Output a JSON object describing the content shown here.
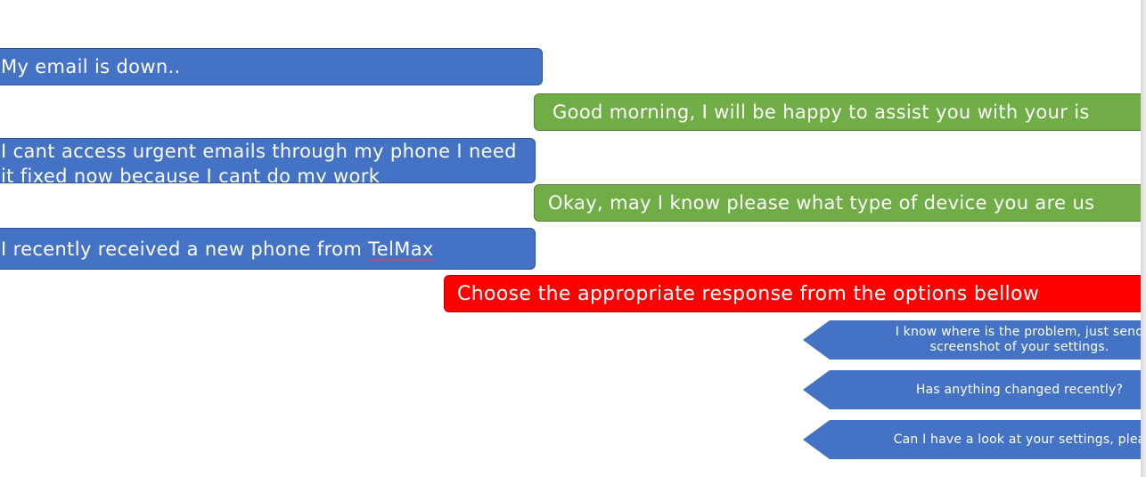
{
  "conversation": {
    "messages": [
      {
        "sender": "customer",
        "color": "#4472c4",
        "text": "My email is down.."
      },
      {
        "sender": "agent",
        "color": "#70ad47",
        "text": "Good morning, I will be happy to assist you with your is"
      },
      {
        "sender": "customer",
        "color": "#4472c4",
        "text": "I cant access urgent emails through my phone I need it fixed now because I cant do my work"
      },
      {
        "sender": "agent",
        "color": "#70ad47",
        "text": "Okay, may I know please what type of device you are us"
      },
      {
        "sender": "customer",
        "color": "#4472c4",
        "text_before": "I recently received a new phone from ",
        "text_flagged": "TelMax"
      }
    ]
  },
  "prompt": {
    "color": "#ff0000",
    "text": "Choose the appropriate response from the options bellow"
  },
  "options": [
    {
      "text": "I know where is the problem, just send screenshot of your settings."
    },
    {
      "text": "Has anything changed recently?"
    },
    {
      "text": "Can I have a look at your settings, plea"
    }
  ]
}
